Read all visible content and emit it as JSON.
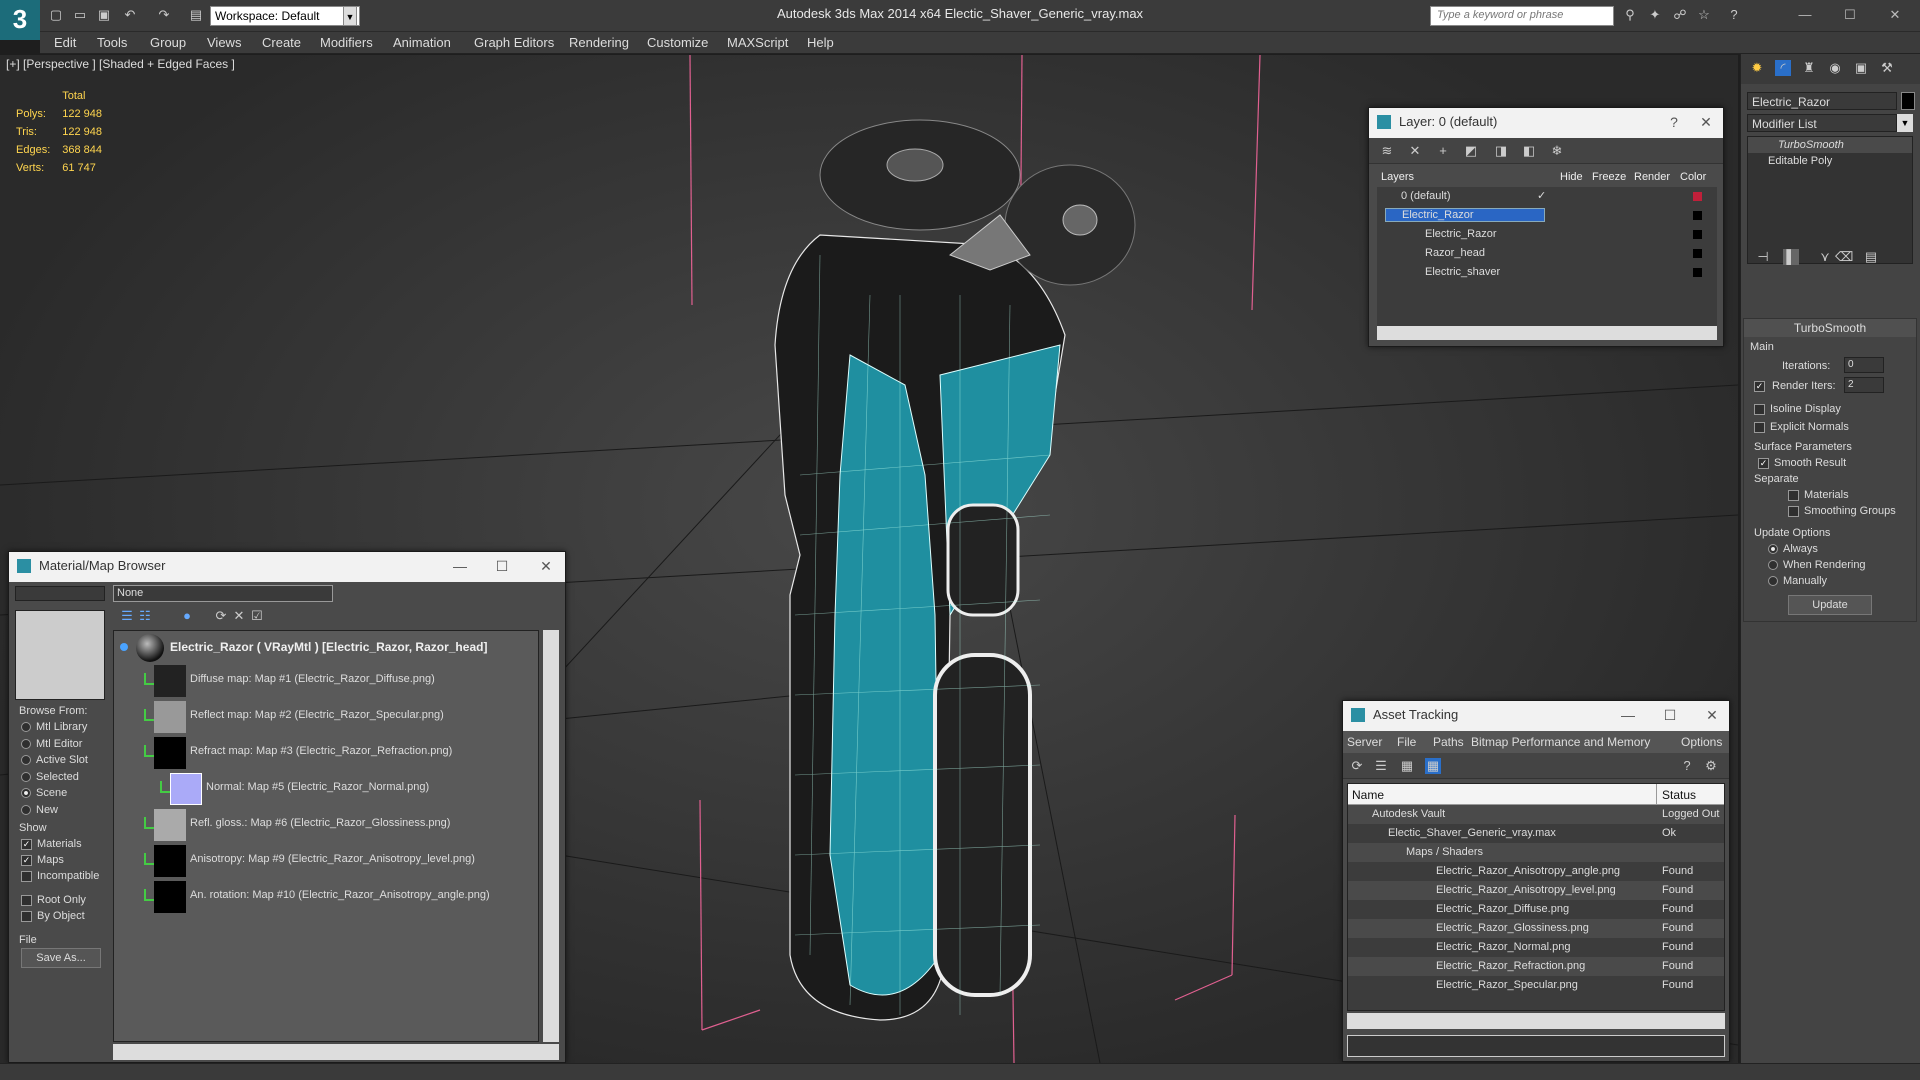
{
  "app": {
    "title": "Autodesk 3ds Max  2014 x64      Electic_Shaver_Generic_vray.max",
    "logo": "3",
    "workspace": "Workspace: Default",
    "search_placeholder": "Type a keyword or phrase"
  },
  "menu": [
    "Edit",
    "Tools",
    "Group",
    "Views",
    "Create",
    "Modifiers",
    "Animation",
    "Graph Editors",
    "Rendering",
    "Customize",
    "MAXScript",
    "Help"
  ],
  "viewport": {
    "label": "[+] [Perspective ] [Shaded + Edged Faces ]",
    "stats": {
      "header": "Total",
      "rows": [
        {
          "k": "Polys:",
          "v": "122 948"
        },
        {
          "k": "Tris:",
          "v": "122 948"
        },
        {
          "k": "Edges:",
          "v": "368 844"
        },
        {
          "k": "Verts:",
          "v": "61 747"
        }
      ]
    }
  },
  "layer_window": {
    "title": "Layer: 0 (default)",
    "columns": {
      "layers": "Layers",
      "hide": "Hide",
      "freeze": "Freeze",
      "render": "Render",
      "color": "Color"
    },
    "rows": [
      {
        "name": "0 (default)",
        "color": "#c0203a"
      },
      {
        "name": "Electric_Razor",
        "color": "#000000"
      },
      {
        "name": "Electric_Razor",
        "color": "#000000"
      },
      {
        "name": "Razor_head",
        "color": "#000000"
      },
      {
        "name": "Electric_shaver",
        "color": "#000000"
      }
    ]
  },
  "material_browser": {
    "title": "Material/Map Browser",
    "filter_value": "None",
    "browse_from_label": "Browse From:",
    "browse_from": [
      "Mtl Library",
      "Mtl Editor",
      "Active Slot",
      "Selected",
      "Scene",
      "New"
    ],
    "browse_from_selected": "Scene",
    "show_label": "Show",
    "show": [
      {
        "label": "Materials",
        "checked": true
      },
      {
        "label": "Maps",
        "checked": true
      },
      {
        "label": "Incompatible",
        "checked": false
      }
    ],
    "extra": [
      {
        "label": "Root Only",
        "checked": false
      },
      {
        "label": "By Object",
        "checked": false
      }
    ],
    "file_label": "File",
    "save_as": "Save As...",
    "root_item": "Electric_Razor  ( VRayMtl )  [Electric_Razor, Razor_head]",
    "maps": [
      "Diffuse map: Map #1 (Electric_Razor_Diffuse.png)",
      "Reflect map: Map #2 (Electric_Razor_Specular.png)",
      "Refract map: Map #3 (Electric_Razor_Refraction.png)",
      "Normal: Map #5 (Electric_Razor_Normal.png)",
      "Refl. gloss.: Map #6 (Electric_Razor_Glossiness.png)",
      "Anisotropy: Map #9 (Electric_Razor_Anisotropy_level.png)",
      "An. rotation: Map #10 (Electric_Razor_Anisotropy_angle.png)"
    ]
  },
  "asset_tracking": {
    "title": "Asset Tracking",
    "menu": [
      "Server",
      "File",
      "Paths",
      "Bitmap Performance and Memory",
      "Options"
    ],
    "col_name": "Name",
    "col_status": "Status",
    "rows": [
      {
        "name": "Autodesk Vault",
        "status": "Logged Out"
      },
      {
        "name": "Electic_Shaver_Generic_vray.max",
        "status": "Ok"
      },
      {
        "name": "Maps / Shaders",
        "status": ""
      },
      {
        "name": "Electric_Razor_Anisotropy_angle.png",
        "status": "Found"
      },
      {
        "name": "Electric_Razor_Anisotropy_level.png",
        "status": "Found"
      },
      {
        "name": "Electric_Razor_Diffuse.png",
        "status": "Found"
      },
      {
        "name": "Electric_Razor_Glossiness.png",
        "status": "Found"
      },
      {
        "name": "Electric_Razor_Normal.png",
        "status": "Found"
      },
      {
        "name": "Electric_Razor_Refraction.png",
        "status": "Found"
      },
      {
        "name": "Electric_Razor_Specular.png",
        "status": "Found"
      }
    ]
  },
  "command_panel": {
    "object_name": "Electric_Razor",
    "modifier_list": "Modifier List",
    "stack": [
      "TurboSmooth",
      "Editable Poly"
    ],
    "rollout_title": "TurboSmooth",
    "main_label": "Main",
    "iterations_label": "Iterations:",
    "iterations_value": "0",
    "render_iters_label": "Render Iters:",
    "render_iters_value": "2",
    "isoline": "Isoline Display",
    "explicit_normals": "Explicit Normals",
    "surface_params": "Surface Parameters",
    "smooth_result": "Smooth Result",
    "separate": "Separate",
    "materials": "Materials",
    "smoothing_groups": "Smoothing Groups",
    "update_options": "Update Options",
    "always": "Always",
    "when_rendering": "When Rendering",
    "manually": "Manually",
    "update_button": "Update"
  }
}
